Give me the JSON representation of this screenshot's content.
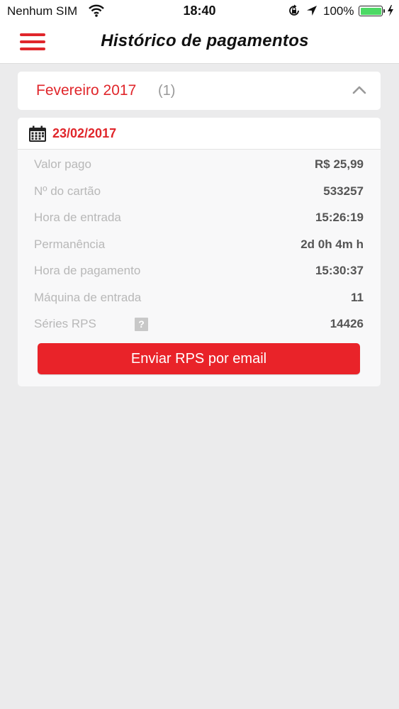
{
  "status_bar": {
    "carrier": "Nenhum SIM",
    "time": "18:40",
    "battery_percent": "100%",
    "battery_level": 1.0,
    "icons": [
      "wifi-icon",
      "rotation-lock-icon",
      "location-arrow-icon",
      "battery-icon",
      "charging-bolt-icon"
    ]
  },
  "nav": {
    "title": "Histórico de pagamentos",
    "menu_icon": "hamburger-menu-icon"
  },
  "month_group": {
    "label": "Fevereiro 2017",
    "count": "(1)",
    "expanded": true,
    "toggle_icon": "chevron-up-icon"
  },
  "payment": {
    "date": "23/02/2017",
    "date_icon": "calendar-icon",
    "rows": [
      {
        "label": "Valor pago",
        "value": "R$ 25,99"
      },
      {
        "label": "Nº do cartão",
        "value": "533257"
      },
      {
        "label": "Hora de entrada",
        "value": "15:26:19"
      },
      {
        "label": "Permanência",
        "value": "2d 0h 4m h"
      },
      {
        "label": "Hora de pagamento",
        "value": "15:30:37"
      },
      {
        "label": "Máquina de entrada",
        "value": "11"
      },
      {
        "label": "Séries RPS",
        "value": "14426",
        "help": "?"
      }
    ],
    "send_button_label": "Enviar RPS por email"
  },
  "colors": {
    "accent": "#e0262b",
    "button": "#e92329",
    "background": "#ebebec",
    "label_gray": "#b8b8b8",
    "value_gray": "#555555"
  }
}
